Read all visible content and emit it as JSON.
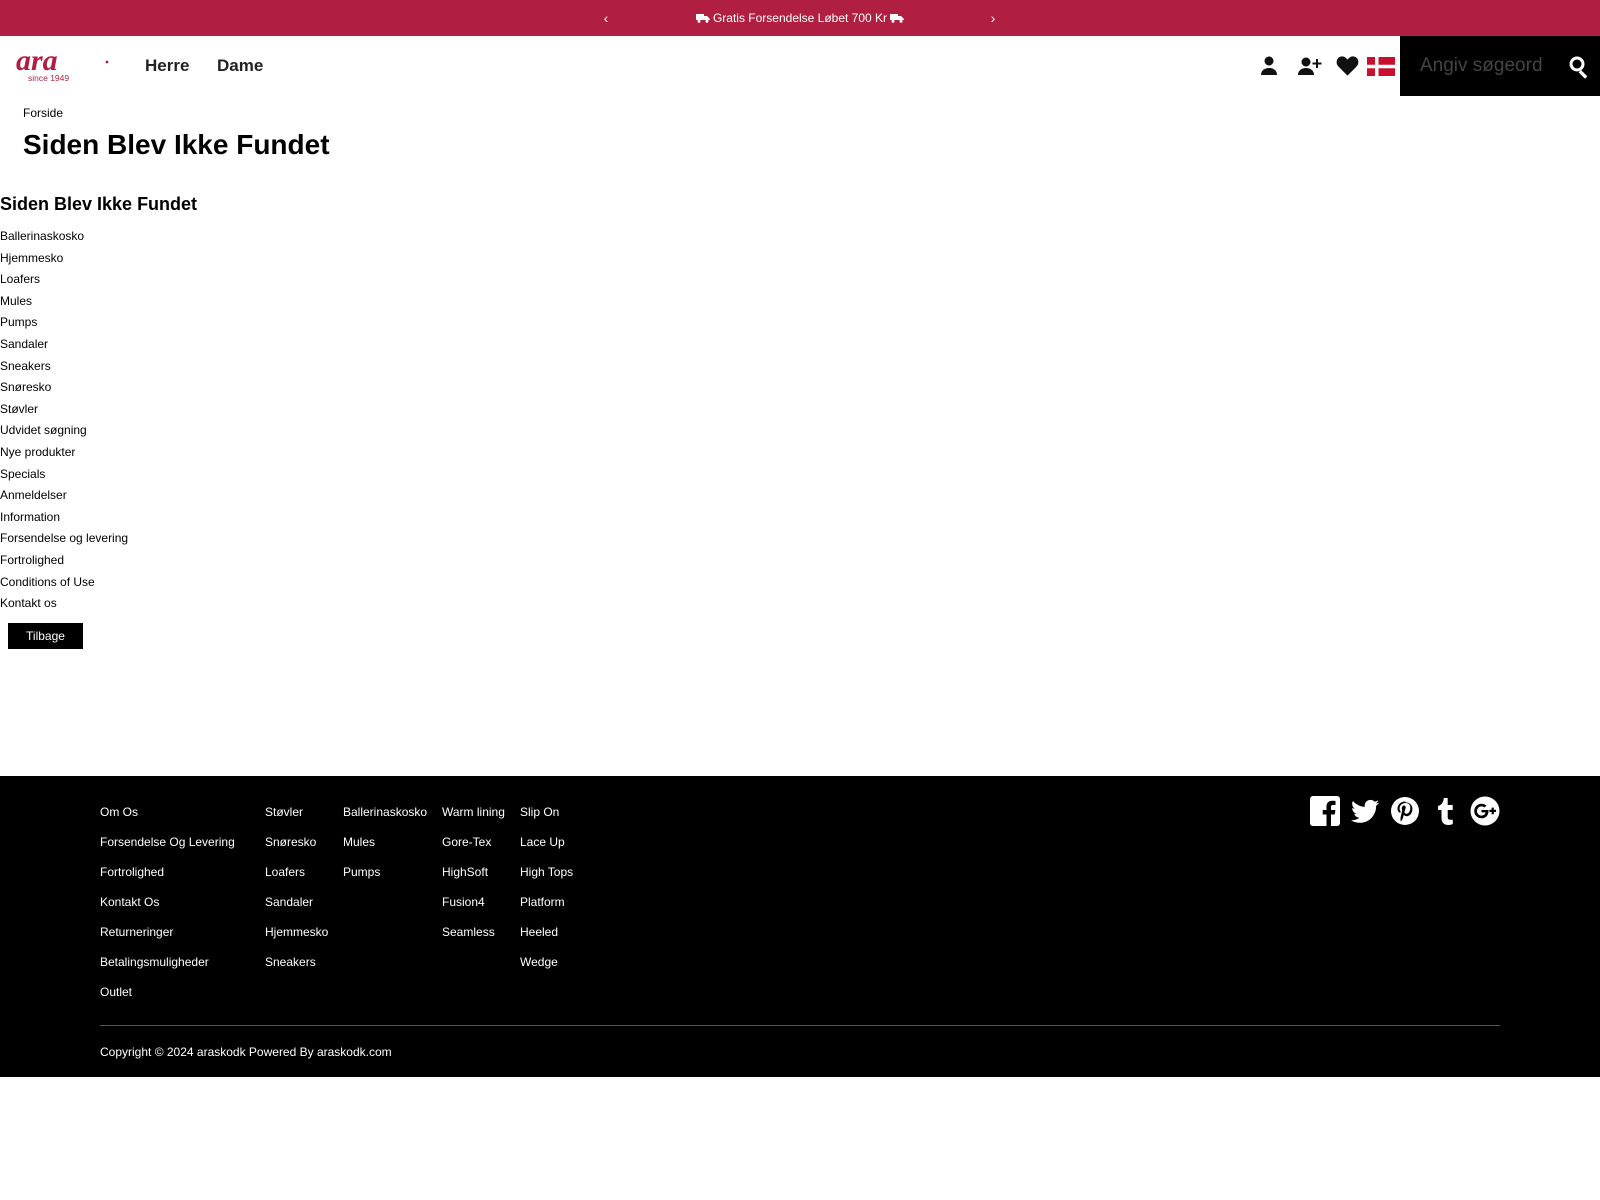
{
  "announcement": {
    "prev_label": "‹",
    "next_label": "›",
    "message": "Gratis Forsendelse Løbet 700 Kr"
  },
  "header": {
    "logo_text": "ara",
    "logo_tagline": "since 1949",
    "nav": [
      "Herre",
      "Dame"
    ],
    "icons": [
      "account-icon",
      "register-icon",
      "wishlist-heart-icon",
      "danish-flag-icon"
    ],
    "search_placeholder": "Angiv søgeord",
    "brand_color": "#b01f41"
  },
  "breadcrumb": "Forside",
  "page_title": "Siden Blev Ikke Fundet",
  "content_heading": "Siden Blev Ikke Fundet",
  "sitemap_links": [
    "Ballerinaskosko",
    "Hjemmesko",
    "Loafers",
    "Mules",
    "Pumps",
    "Sandaler",
    "Sneakers",
    "Snøresko",
    "Støvler",
    "Udvidet søgning",
    "Nye produkter",
    "Specials",
    "Anmeldelser",
    "Information",
    "Forsendelse og levering",
    "Fortrolighed",
    "Conditions of Use",
    "Kontakt os"
  ],
  "back_button": "Tilbage",
  "footer": {
    "columns": [
      [
        "Om Os",
        "Forsendelse Og Levering",
        "Fortrolighed",
        "Kontakt Os",
        "Returneringer",
        "Betalingsmuligheder",
        "Outlet"
      ],
      [
        "Støvler",
        "Snøresko",
        "Loafers",
        "Sandaler",
        "Hjemmesko",
        "Sneakers"
      ],
      [
        "Ballerinaskosko",
        "Mules",
        "Pumps"
      ],
      [
        "Warm lining",
        "Gore-Tex",
        "HighSoft",
        "Fusion4",
        "Seamless"
      ],
      [
        "Slip On",
        "Lace Up",
        "High Tops",
        "Platform",
        "Heeled",
        "Wedge"
      ]
    ],
    "social": [
      "facebook-icon",
      "twitter-icon",
      "pinterest-icon",
      "tumblr-icon",
      "google-plus-icon"
    ],
    "copyright": "Copyright © 2024 araskodk Powered By araskodk.com"
  }
}
